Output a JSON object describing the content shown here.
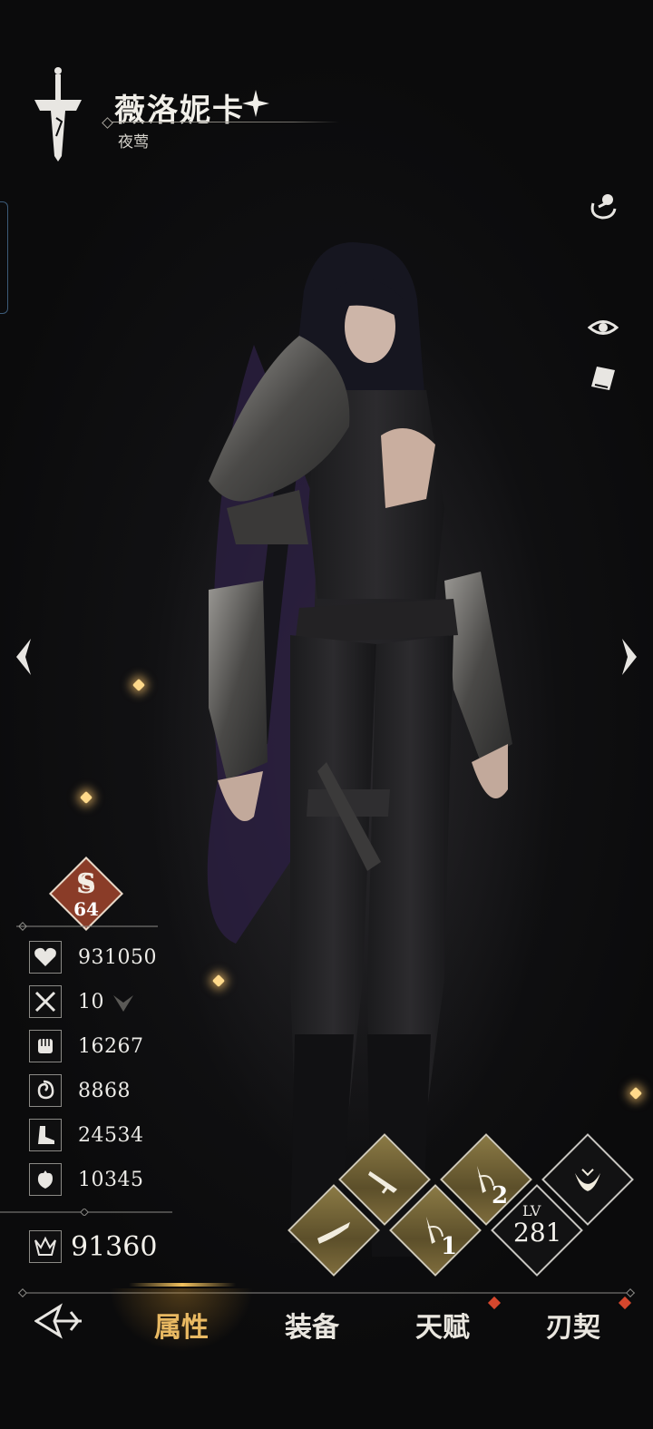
{
  "character": {
    "name": "薇洛妮卡",
    "title": "夜莺"
  },
  "side_icons": [
    "broadcast-icon",
    "eye-icon",
    "card-icon"
  ],
  "rank": {
    "grade_icon": "ss-grade",
    "level": "64"
  },
  "stats": [
    {
      "icon": "heart-icon",
      "value": "931050"
    },
    {
      "icon": "crossed-swords-icon",
      "value": "10"
    },
    {
      "icon": "fist-icon",
      "value": "16267"
    },
    {
      "icon": "spiral-icon",
      "value": "8868"
    },
    {
      "icon": "boot-icon",
      "value": "24534"
    },
    {
      "icon": "anatomical-heart-icon",
      "value": "10345"
    }
  ],
  "combat_power": "91360",
  "skills": {
    "slot_1": "1",
    "slot_2": "2",
    "level_label": "LV",
    "level_value": "281"
  },
  "nav": {
    "tabs": [
      {
        "label": "属性",
        "active": true
      },
      {
        "label": "装备",
        "active": false,
        "notify": false
      },
      {
        "label": "天赋",
        "active": false,
        "notify": true
      },
      {
        "label": "刃契",
        "active": false,
        "notify": true
      }
    ]
  },
  "colors": {
    "accent_gold": "#e9b962",
    "notify_red": "#d6472d",
    "rank_badge": "#8a3c28"
  }
}
